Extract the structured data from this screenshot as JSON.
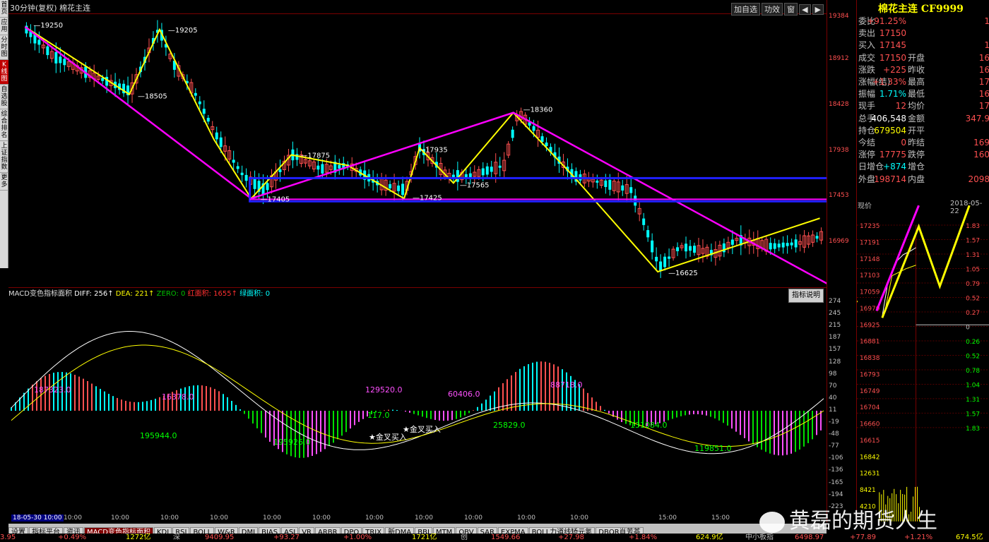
{
  "window": {
    "title": "30分钟(复权)  棉花主连",
    "buttons": [
      "加自选",
      "功效",
      "窗",
      "◀",
      "▶"
    ]
  },
  "left_nav": [
    "首页",
    "应用",
    "分时图",
    "K线图",
    "自选股",
    "综合排名",
    "上证指数",
    "更多"
  ],
  "left_nav_active": 3,
  "quote": {
    "title": "棉花主连 CF9999",
    "rows": [
      {
        "l": "委比",
        "v": "+91.25%",
        "c": "#ff5050",
        "l2": "",
        "v2": "1"
      },
      {
        "l": "卖出",
        "v": "17150",
        "c": "#ff5050",
        "l2": "",
        "v2": ""
      },
      {
        "l": "买入",
        "v": "17145",
        "c": "#ff5050",
        "l2": "",
        "v2": "1"
      },
      {
        "l": "成交",
        "v": "17150",
        "c": "#ff5050",
        "l2": "开盘",
        "v2": "16"
      },
      {
        "l": "涨跌",
        "v": "+225",
        "c": "#ff5050",
        "l2": "昨收",
        "v2": "16"
      },
      {
        "l": "涨幅(结)",
        "v": "+1.33%",
        "c": "#ff5050",
        "l2": "最高",
        "v2": "17"
      },
      {
        "l": "振幅",
        "v": "1.71%",
        "c": "#00ffff",
        "l2": "最低",
        "v2": "16"
      },
      {
        "l": "现手",
        "v": "12",
        "c": "#ff5050",
        "l2": "均价",
        "v2": "17"
      },
      {
        "l": "总手",
        "v": "406,548",
        "c": "#ffffff",
        "l2": "金额",
        "v2": "347.9"
      },
      {
        "l": "持仓",
        "v": "679504",
        "c": "#ffff00",
        "l2": "开平",
        "v2": ""
      },
      {
        "l": "今结",
        "v": "0",
        "c": "#ff5050",
        "l2": "昨结",
        "v2": "169"
      },
      {
        "l": "涨停",
        "v": "17775",
        "c": "#ff5050",
        "l2": "跌停",
        "v2": "160"
      },
      {
        "l": "日增仓",
        "v": "+874",
        "c": "#00ffff",
        "l2": "增仓",
        "v2": ""
      },
      {
        "l": "外盘",
        "v": "198714",
        "c": "#ff5050",
        "l2": "内盘",
        "v2": "2098"
      }
    ],
    "now_label": "现价",
    "date": "2018-05-22"
  },
  "macd_header": {
    "name": "MACD变色指标面积",
    "diff_label": "DIFF:",
    "diff": "256↑",
    "dea_label": "DEA:",
    "dea": "221↑",
    "zero_label": "ZERO:",
    "zero": "0",
    "red_label": "红面积:",
    "red": "1655↑",
    "green_label": "绿面积:",
    "green": "0",
    "help": "指标说明"
  },
  "price_ticks": [
    "19384",
    "18912",
    "18428",
    "17938",
    "17453",
    "16969"
  ],
  "macd_ticks": [
    "274",
    "245",
    "215",
    "187",
    "157",
    "128",
    "98",
    "70",
    "40",
    "11",
    "-19",
    "-48",
    "-77",
    "-106",
    "-136",
    "-165",
    "-194",
    "-223"
  ],
  "mini_left_ticks": [
    "17235",
    "17191",
    "17148",
    "17103",
    "17059",
    "16970",
    "16925",
    "16881",
    "16838",
    "16793",
    "16749",
    "16704",
    "16660",
    "16615",
    "16842",
    "12631",
    "8421",
    "4210"
  ],
  "mini_right_ticks": [
    "1.83",
    "1.57",
    "1.31",
    "1.05",
    "0.79",
    "0.52",
    "0.27",
    "0",
    "0.26",
    "0.52",
    "0.78",
    "1.04",
    "1.31",
    "1.57",
    "1.83"
  ],
  "pivot_labels": [
    {
      "t": "19250"
    },
    {
      "t": "19205"
    },
    {
      "t": "18505"
    },
    {
      "t": "17875"
    },
    {
      "t": "17935"
    },
    {
      "t": "18360"
    },
    {
      "t": "17405"
    },
    {
      "t": "17425"
    },
    {
      "t": "17565"
    },
    {
      "t": "16625"
    }
  ],
  "macd_labels": [
    {
      "t": "187323.0",
      "c": "#ff50ff"
    },
    {
      "t": "16378.0",
      "c": "#ff50ff"
    },
    {
      "t": "129520.0",
      "c": "#ff50ff"
    },
    {
      "t": "60406.0",
      "c": "#ff50ff"
    },
    {
      "t": "88718.0",
      "c": "#ff50ff"
    },
    {
      "t": "195944.0",
      "c": "#00ff00"
    },
    {
      "t": "195926.0",
      "c": "#00ff00"
    },
    {
      "t": "117.0",
      "c": "#00ff00"
    },
    {
      "t": "25829.0",
      "c": "#00ff00"
    },
    {
      "t": "131084.0",
      "c": "#00ff00"
    },
    {
      "t": "119851.0",
      "c": "#00ff00"
    }
  ],
  "signals": [
    "金叉买入",
    "金叉买入"
  ],
  "x_labels": [
    "18-05-30 10:00",
    "10:00",
    "10:00",
    "10:00",
    "10:00",
    "10:00",
    "10:00",
    "10:00",
    "10:00",
    "10:00",
    "10:00",
    "10:00",
    "15:00",
    "15:00"
  ],
  "tabs": [
    "设置",
    "指标平台",
    "资讯",
    "MACD变色指标面积",
    "KDJ",
    "RSI",
    "BOLL",
    "W&R",
    "DMI",
    "BIAS",
    "ASI",
    "VR",
    "ARBR",
    "DPO",
    "TRIX",
    "新DMA",
    "BBI",
    "MTM",
    "OBV",
    "SAR",
    "EXPMA",
    "BOLL力道线矫元氪",
    "DBQR肖芳荟"
  ],
  "active_tab": 3,
  "status": [
    {
      "t": "3.95",
      "c": "#ff5050"
    },
    {
      "t": "+0.49%",
      "c": "#ff5050"
    },
    {
      "t": "1272亿",
      "c": "#ffff00"
    },
    {
      "t": "深",
      "c": "#c0c0c0"
    },
    {
      "t": "9409.95",
      "c": "#ff5050"
    },
    {
      "t": "+93.27",
      "c": "#ff5050"
    },
    {
      "t": "+1.00%",
      "c": "#ff5050"
    },
    {
      "t": "1721亿",
      "c": "#ffff00"
    },
    {
      "t": "创",
      "c": "#c0c0c0"
    },
    {
      "t": "1549.66",
      "c": "#ff5050"
    },
    {
      "t": "+27.98",
      "c": "#ff5050"
    },
    {
      "t": "+1.84%",
      "c": "#ff5050"
    },
    {
      "t": "624.9亿",
      "c": "#ffff00"
    },
    {
      "t": "中小板指",
      "c": "#c0c0c0"
    },
    {
      "t": "6498.97",
      "c": "#ff5050"
    },
    {
      "t": "+77.89",
      "c": "#ff5050"
    },
    {
      "t": "+1.21%",
      "c": "#ff5050"
    },
    {
      "t": "674.5亿",
      "c": "#ffff00"
    }
  ],
  "watermark": "黄磊的期货人生",
  "colors": {
    "up": "#ff5050",
    "down": "#00ffff",
    "zigzag": "#ffff00",
    "trend": "#ff00ff",
    "box": "#2020ff"
  }
}
